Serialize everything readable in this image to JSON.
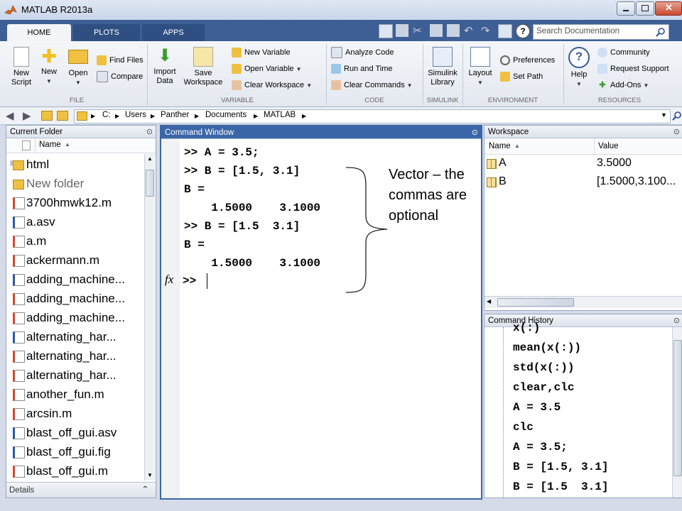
{
  "window": {
    "title": "MATLAB R2013a"
  },
  "tabs": [
    {
      "label": "HOME"
    },
    {
      "label": "PLOTS"
    },
    {
      "label": "APPS"
    }
  ],
  "search": {
    "placeholder": "Search Documentation"
  },
  "ribbon": {
    "file": {
      "label": "FILE",
      "new_script": "New\nScript",
      "new": "New",
      "open": "Open",
      "find_files": "Find Files",
      "compare": "Compare"
    },
    "variable": {
      "label": "VARIABLE",
      "import_data": "Import\nData",
      "save_workspace": "Save\nWorkspace",
      "new_variable": "New Variable",
      "open_variable": "Open Variable",
      "clear_workspace": "Clear Workspace"
    },
    "code": {
      "label": "CODE",
      "analyze_code": "Analyze Code",
      "run_and_time": "Run and Time",
      "clear_commands": "Clear Commands"
    },
    "simulink": {
      "label": "SIMULINK",
      "simulink_library": "Simulink\nLibrary"
    },
    "environment": {
      "label": "ENVIRONMENT",
      "layout": "Layout",
      "preferences": "Preferences",
      "set_path": "Set Path"
    },
    "resources": {
      "label": "RESOURCES",
      "help": "Help",
      "community": "Community",
      "request_support": "Request Support",
      "add_ons": "Add-Ons"
    }
  },
  "address": {
    "drive": "C:",
    "parts": [
      "Users",
      "Panther",
      "Documents",
      "MATLAB"
    ]
  },
  "current_folder": {
    "title": "Current Folder",
    "column_name": "Name",
    "items": [
      {
        "name": "html",
        "type": "folder"
      },
      {
        "name": "New folder",
        "type": "folder"
      },
      {
        "name": "3700hmwk12.m",
        "type": "m"
      },
      {
        "name": "a.asv",
        "type": "asv"
      },
      {
        "name": "a.m",
        "type": "m"
      },
      {
        "name": "ackermann.m",
        "type": "m"
      },
      {
        "name": "adding_machine...",
        "type": "asv"
      },
      {
        "name": "adding_machine...",
        "type": "m"
      },
      {
        "name": "adding_machine...",
        "type": "m"
      },
      {
        "name": "alternating_har...",
        "type": "asv"
      },
      {
        "name": "alternating_har...",
        "type": "m"
      },
      {
        "name": "alternating_har...",
        "type": "m"
      },
      {
        "name": "another_fun.m",
        "type": "m"
      },
      {
        "name": "arcsin.m",
        "type": "m"
      },
      {
        "name": "blast_off_gui.asv",
        "type": "asv"
      },
      {
        "name": "blast_off_gui.fig",
        "type": "fig"
      },
      {
        "name": "blast_off_gui.m",
        "type": "m"
      }
    ],
    "details_label": "Details"
  },
  "command_window": {
    "title": "Command Window",
    "lines": [
      ">> A = 3.5;",
      ">> B = [1.5, 3.1]",
      "B =",
      "    1.5000    3.1000",
      ">> B = [1.5  3.1]",
      "B =",
      "    1.5000    3.1000"
    ],
    "prompt": ">>",
    "fx": "fx",
    "annotation": [
      "Vector – the",
      "commas are",
      "optional"
    ]
  },
  "workspace": {
    "title": "Workspace",
    "col_name": "Name",
    "col_value": "Value",
    "rows": [
      {
        "name": "A",
        "value": "3.5000"
      },
      {
        "name": "B",
        "value": "[1.5000,3.100..."
      }
    ]
  },
  "command_history": {
    "title": "Command History",
    "lines": [
      "x(:)",
      "mean(x(:))",
      "std(x(:))",
      "clear,clc",
      "A = 3.5",
      "clc",
      "A = 3.5;",
      "B = [1.5, 3.1]",
      "B = [1.5  3.1]"
    ]
  },
  "colors": {
    "accent": "#3a66a8",
    "tabbar": "#3d5f95",
    "folder": "#f0c040"
  }
}
